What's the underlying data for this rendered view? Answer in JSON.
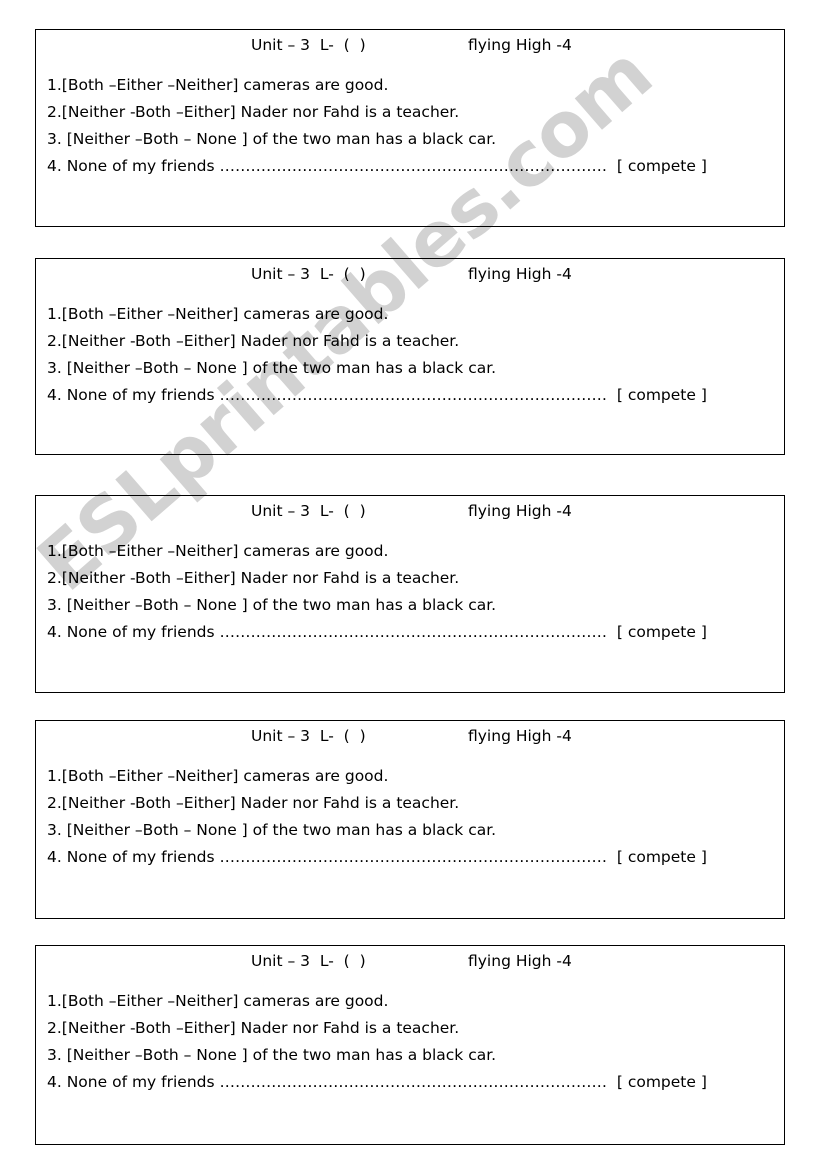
{
  "watermark": {
    "text": "ESLprintables.com",
    "color": "#d2d2d2"
  },
  "page": {
    "background": "#ffffff",
    "border_color": "#000000"
  },
  "worksheet": {
    "header": {
      "left": "Unit – 3  L-  (  )",
      "right": "flying High -4"
    },
    "questions": [
      "1.[Both –Either –Neither] cameras are good.",
      "2.[Neither -Both –Either] Nader nor Fahd is a teacher.",
      "3. [Neither –Both – None ] of the two man has a black car.",
      "4. None of my friends "
    ],
    "fill_blank": {
      "prefix": "4. None of my friends ",
      "dots": "…………………………………………………………………",
      "cue": "[ compete ]"
    }
  },
  "cards": [
    {
      "index": 1,
      "header": {
        "left": "Unit – 3  L-  (  )",
        "right": "flying High -4"
      },
      "lines": [
        "1.[Both –Either –Neither] cameras are good.",
        "2.[Neither -Both –Either] Nader nor Fahd is a teacher.",
        "3. [Neither –Both – None ] of the two man has a black car."
      ],
      "blank_prefix": "4. None of my friends ",
      "blank_dots": "…………………………………………………………………",
      "blank_cue": "[ compete ]"
    },
    {
      "index": 2,
      "header": {
        "left": "Unit – 3  L-  (  )",
        "right": "flying High -4"
      },
      "lines": [
        "1.[Both –Either –Neither] cameras are good.",
        "2.[Neither -Both –Either] Nader nor Fahd is a teacher.",
        "3. [Neither –Both – None ] of the two man has a black car."
      ],
      "blank_prefix": "4. None of my friends ",
      "blank_dots": "…………………………………………………………………",
      "blank_cue": "[ compete ]"
    },
    {
      "index": 3,
      "header": {
        "left": "Unit – 3  L-  (  )",
        "right": "flying High -4"
      },
      "lines": [
        "1.[Both –Either –Neither] cameras are good.",
        "2.[Neither -Both –Either] Nader nor Fahd is a teacher.",
        "3. [Neither –Both – None ] of the two man has a black car."
      ],
      "blank_prefix": "4. None of my friends ",
      "blank_dots": "…………………………………………………………………",
      "blank_cue": "[ compete ]"
    },
    {
      "index": 4,
      "header": {
        "left": "Unit – 3  L-  (  )",
        "right": "flying High -4"
      },
      "lines": [
        "1.[Both –Either –Neither] cameras are good.",
        "2.[Neither -Both –Either] Nader nor Fahd is a teacher.",
        "3. [Neither –Both – None ] of the two man has a black car."
      ],
      "blank_prefix": "4. None of my friends ",
      "blank_dots": "…………………………………………………………………",
      "blank_cue": "[ compete ]"
    },
    {
      "index": 5,
      "header": {
        "left": "Unit – 3  L-  (  )",
        "right": "flying High -4"
      },
      "lines": [
        "1.[Both –Either –Neither] cameras are good.",
        "2.[Neither -Both –Either] Nader nor Fahd is a teacher.",
        "3. [Neither –Both – None ] of the two man has a black car."
      ],
      "blank_prefix": "4. None of my friends ",
      "blank_dots": "…………………………………………………………………",
      "blank_cue": "[ compete ]"
    }
  ]
}
